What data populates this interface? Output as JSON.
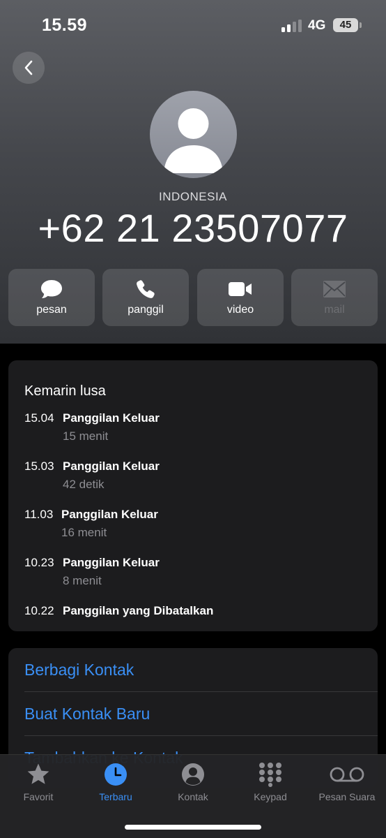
{
  "status_bar": {
    "time": "15.59",
    "network": "4G",
    "battery": "45"
  },
  "contact": {
    "country": "INDONESIA",
    "phone": "+62 21 23507077"
  },
  "actions": [
    {
      "label": "pesan",
      "icon": "message-icon",
      "enabled": true
    },
    {
      "label": "panggil",
      "icon": "phone-icon",
      "enabled": true
    },
    {
      "label": "video",
      "icon": "video-icon",
      "enabled": true
    },
    {
      "label": "mail",
      "icon": "mail-icon",
      "enabled": false
    }
  ],
  "history": {
    "title": "Kemarin lusa",
    "entries": [
      {
        "time": "15.04",
        "type": "Panggilan Keluar",
        "duration": "15 menit"
      },
      {
        "time": "15.03",
        "type": "Panggilan Keluar",
        "duration": "42 detik"
      },
      {
        "time": "11.03",
        "type": "Panggilan Keluar",
        "duration": "16 menit"
      },
      {
        "time": "10.23",
        "type": "Panggilan Keluar",
        "duration": "8 menit"
      },
      {
        "time": "10.22",
        "type": "Panggilan yang Dibatalkan",
        "duration": ""
      }
    ]
  },
  "links": {
    "share": "Berbagi Kontak",
    "create": "Buat Kontak Baru",
    "add": "Tambahkan ke Kontak"
  },
  "tabs": [
    {
      "label": "Favorit",
      "icon": "star-icon",
      "active": false
    },
    {
      "label": "Terbaru",
      "icon": "clock-icon",
      "active": true
    },
    {
      "label": "Kontak",
      "icon": "person-icon",
      "active": false
    },
    {
      "label": "Keypad",
      "icon": "keypad-icon",
      "active": false
    },
    {
      "label": "Pesan Suara",
      "icon": "voicemail-icon",
      "active": false
    }
  ],
  "colors": {
    "accent": "#3a8ff5",
    "card": "#1c1c1e",
    "secondary_text": "#8e8e93"
  }
}
